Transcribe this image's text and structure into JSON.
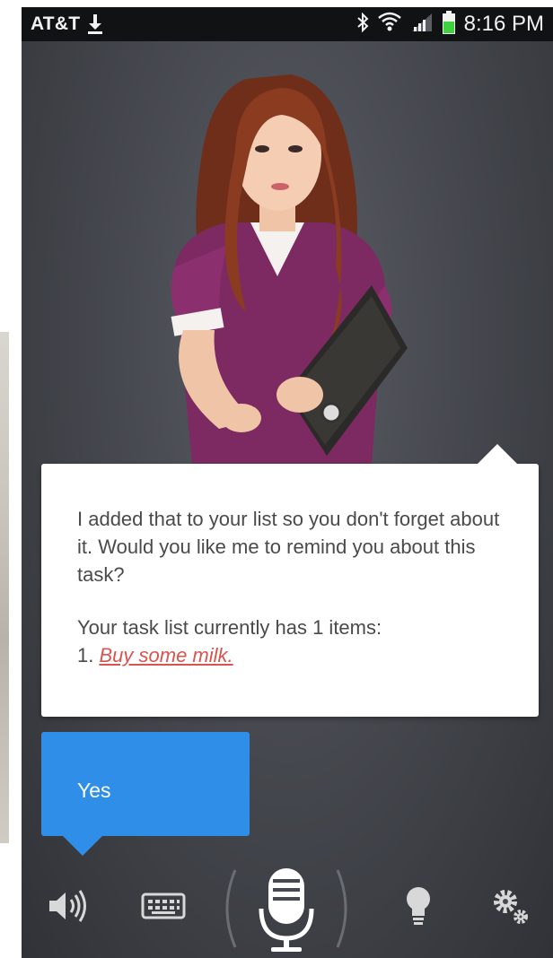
{
  "status_bar": {
    "carrier": "AT&T",
    "time": "8:16 PM",
    "icons": [
      "download-icon",
      "bluetooth-icon",
      "wifi-icon",
      "signal-icon",
      "battery-icon"
    ],
    "battery_color": "#3fd13f"
  },
  "assistant": {
    "icon": "assistant-avatar"
  },
  "speech": {
    "line1": "I added that to your list so you don't forget about it. Would you like me to remind you about this task?",
    "line2": "Your task list currently has 1 items:",
    "task_number": "1.",
    "task_item": "Buy some milk."
  },
  "reply": {
    "label": "Yes",
    "color": "#2f8fe8"
  },
  "toolbar": {
    "items": [
      "speaker-icon",
      "keyboard-icon",
      "microphone-icon",
      "lightbulb-icon",
      "settings-gears-icon"
    ]
  }
}
